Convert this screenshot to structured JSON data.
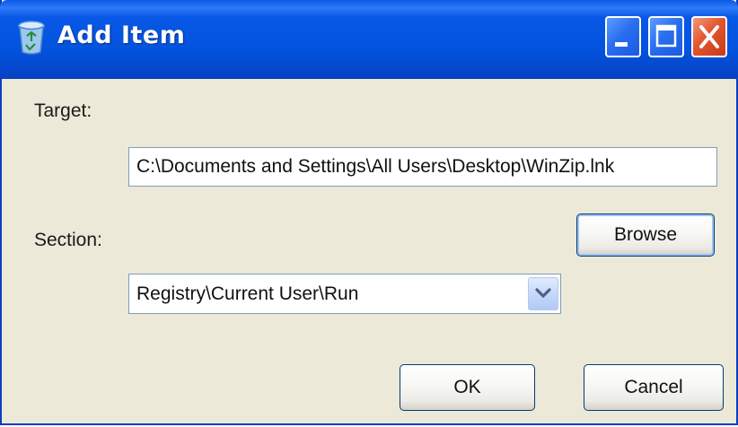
{
  "window": {
    "title": "Add Item",
    "app_icon": "recycle-bin-icon",
    "controls": [
      "minimize-icon",
      "maximize-icon",
      "close-icon"
    ],
    "accent_color": "#0054e3",
    "background_color": "#ece9d8"
  },
  "form": {
    "target_label": "Target:",
    "target_value": "C:\\Documents and Settings\\All Users\\Desktop\\WinZip.lnk",
    "section_label": "Section:",
    "section_value": "Registry\\Current User\\Run",
    "browse_label": "Browse"
  },
  "actions": {
    "ok_label": "OK",
    "cancel_label": "Cancel"
  }
}
